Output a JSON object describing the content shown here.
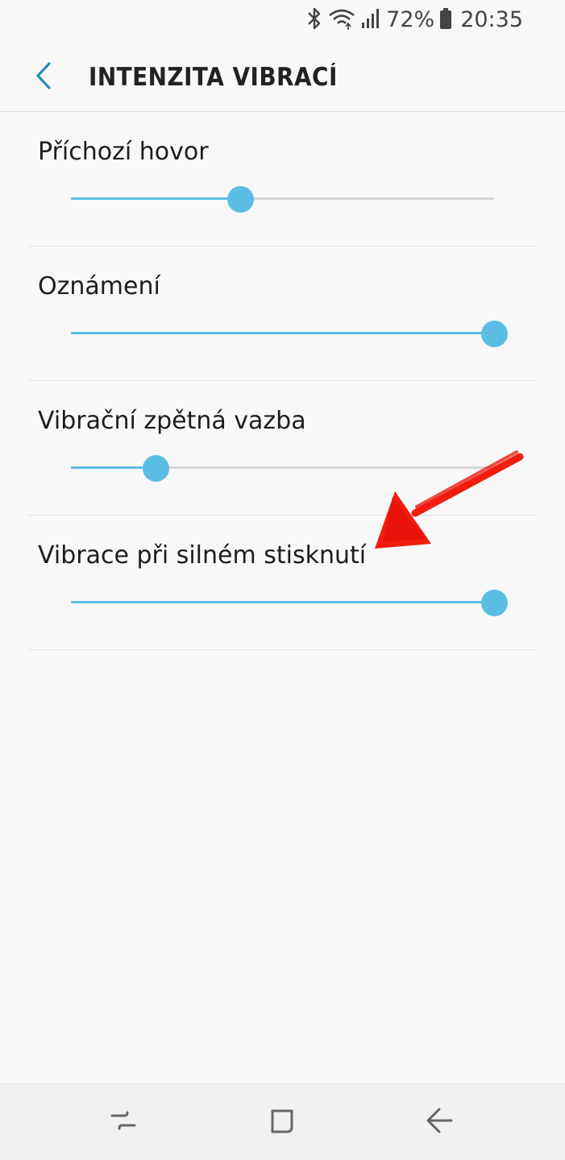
{
  "status_bar": {
    "battery": "72%",
    "time": "20:35",
    "icons": [
      "bluetooth-icon",
      "wifi-icon",
      "signal-icon",
      "battery-icon"
    ]
  },
  "header": {
    "title": "INTENZITA VIBRACÍ",
    "back_icon": "chevron-left-icon"
  },
  "settings": [
    {
      "label": "Příchozí hovor",
      "level": 0.4
    },
    {
      "label": "Oznámení",
      "level": 1.0
    },
    {
      "label": "Vibrační zpětná vazba",
      "level": 0.2
    },
    {
      "label": "Vibrace při silném stisknutí",
      "level": 1.0
    }
  ],
  "navigation": {
    "buttons": [
      "recent-apps-icon",
      "home-icon",
      "back-icon"
    ]
  },
  "colors": {
    "accent": "#5bbde4",
    "back_chevron": "#2a8fb0",
    "annotation": "#f01d0f"
  }
}
